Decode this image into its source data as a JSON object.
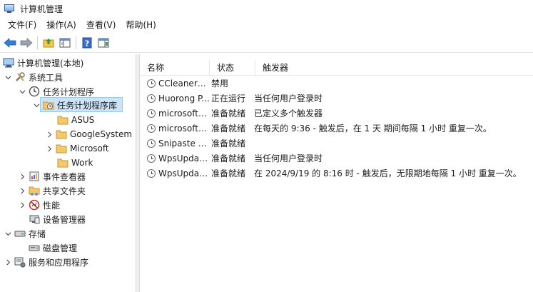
{
  "window": {
    "title": "计算机管理"
  },
  "menu": [
    "文件(F)",
    "操作(A)",
    "查看(V)",
    "帮助(H)"
  ],
  "tree": {
    "root": "计算机管理(本地)",
    "system_tools": "系统工具",
    "task_scheduler": "任务计划程序",
    "task_library": "任务计划程序库",
    "folders": [
      "ASUS",
      "GoogleSystem",
      "Microsoft",
      "Work"
    ],
    "event_viewer": "事件查看器",
    "shared_folders": "共享文件夹",
    "performance": "性能",
    "device_manager": "设备管理器",
    "storage": "存储",
    "disk_management": "磁盘管理",
    "services_apps": "服务和应用程序"
  },
  "list": {
    "columns": [
      "名称",
      "状态",
      "触发器"
    ],
    "rows": [
      {
        "name": "CCleanerSk...",
        "status": "禁用",
        "trigger": ""
      },
      {
        "name": "Huorong P...",
        "status": "正在运行",
        "trigger": "当任何用户登录时"
      },
      {
        "name": "microsofte...",
        "status": "准备就绪",
        "trigger": "已定义多个触发器"
      },
      {
        "name": "microsofte...",
        "status": "准备就绪",
        "trigger": "在每天的 9:36 - 触发后，在 1 天 期间每隔 1 小时 重复一次。"
      },
      {
        "name": "Snipaste (R...",
        "status": "准备就绪",
        "trigger": ""
      },
      {
        "name": "WpsUpdat...",
        "status": "准备就绪",
        "trigger": "当任何用户登录时"
      },
      {
        "name": "WpsUpdat...",
        "status": "准备就绪",
        "trigger": "在 2024/9/19 的 8:16 时 - 触发后，无限期地每隔 1 小时 重复一次。"
      }
    ]
  },
  "colors": {
    "selection": "#cce4f7",
    "accent": "#0067c0"
  }
}
